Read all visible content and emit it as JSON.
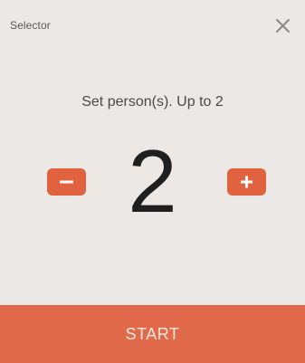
{
  "dialog": {
    "title": "Selector",
    "close_icon": "close-icon"
  },
  "selector": {
    "prompt": "Set person(s). Up to 2",
    "count": "2",
    "max": 2,
    "minus_icon": "minus-icon",
    "plus_icon": "plus-icon"
  },
  "actions": {
    "start_label": "START"
  },
  "colors": {
    "accent": "#e0623e",
    "start_bg": "#e06a49",
    "dialog_bg": "#ebe8e5"
  }
}
